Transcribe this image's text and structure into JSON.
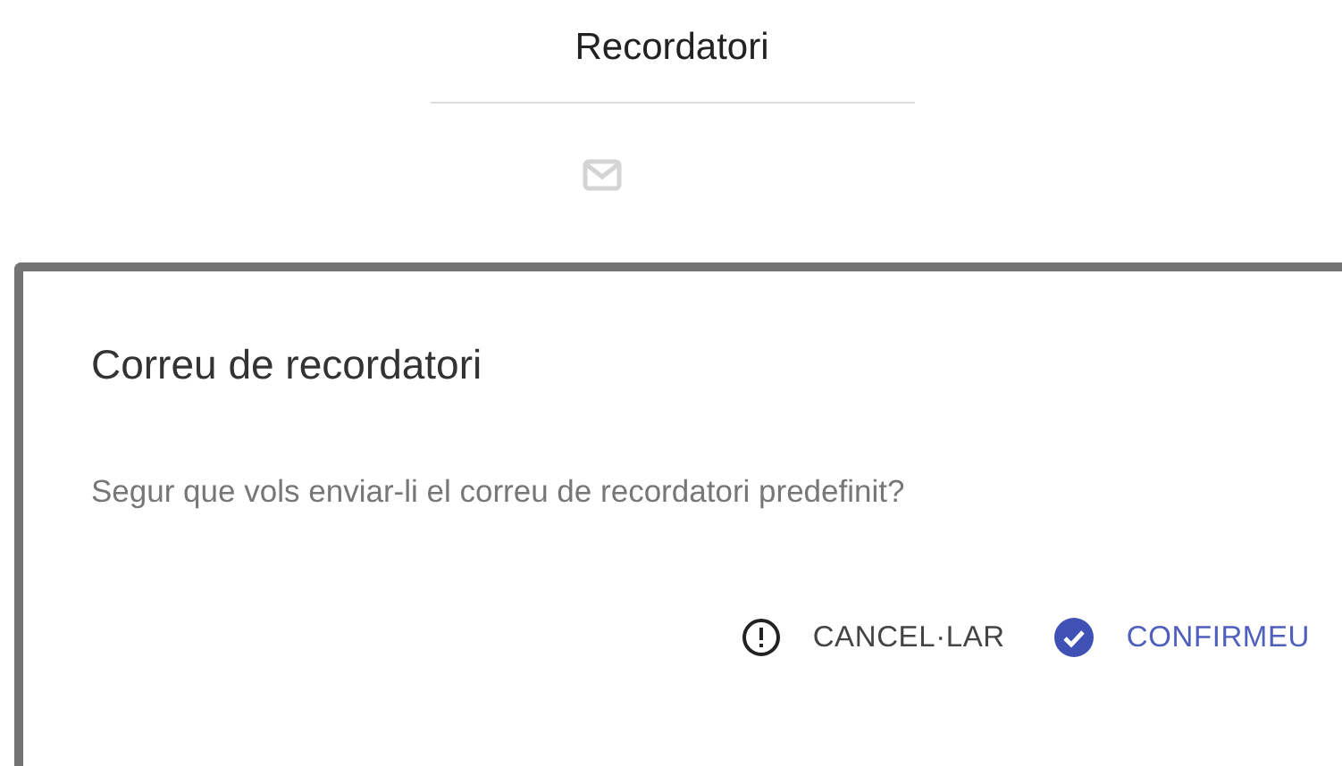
{
  "header": {
    "title": "Recordatori"
  },
  "dialog": {
    "title": "Correu de recordatori",
    "message": "Segur que vols enviar-li el correu de recordatori predefinit?",
    "buttons": [
      {
        "kind": "cancel",
        "label": "CANCEL·LAR"
      },
      {
        "kind": "confirm",
        "label": "CONFIRMEU"
      }
    ]
  }
}
